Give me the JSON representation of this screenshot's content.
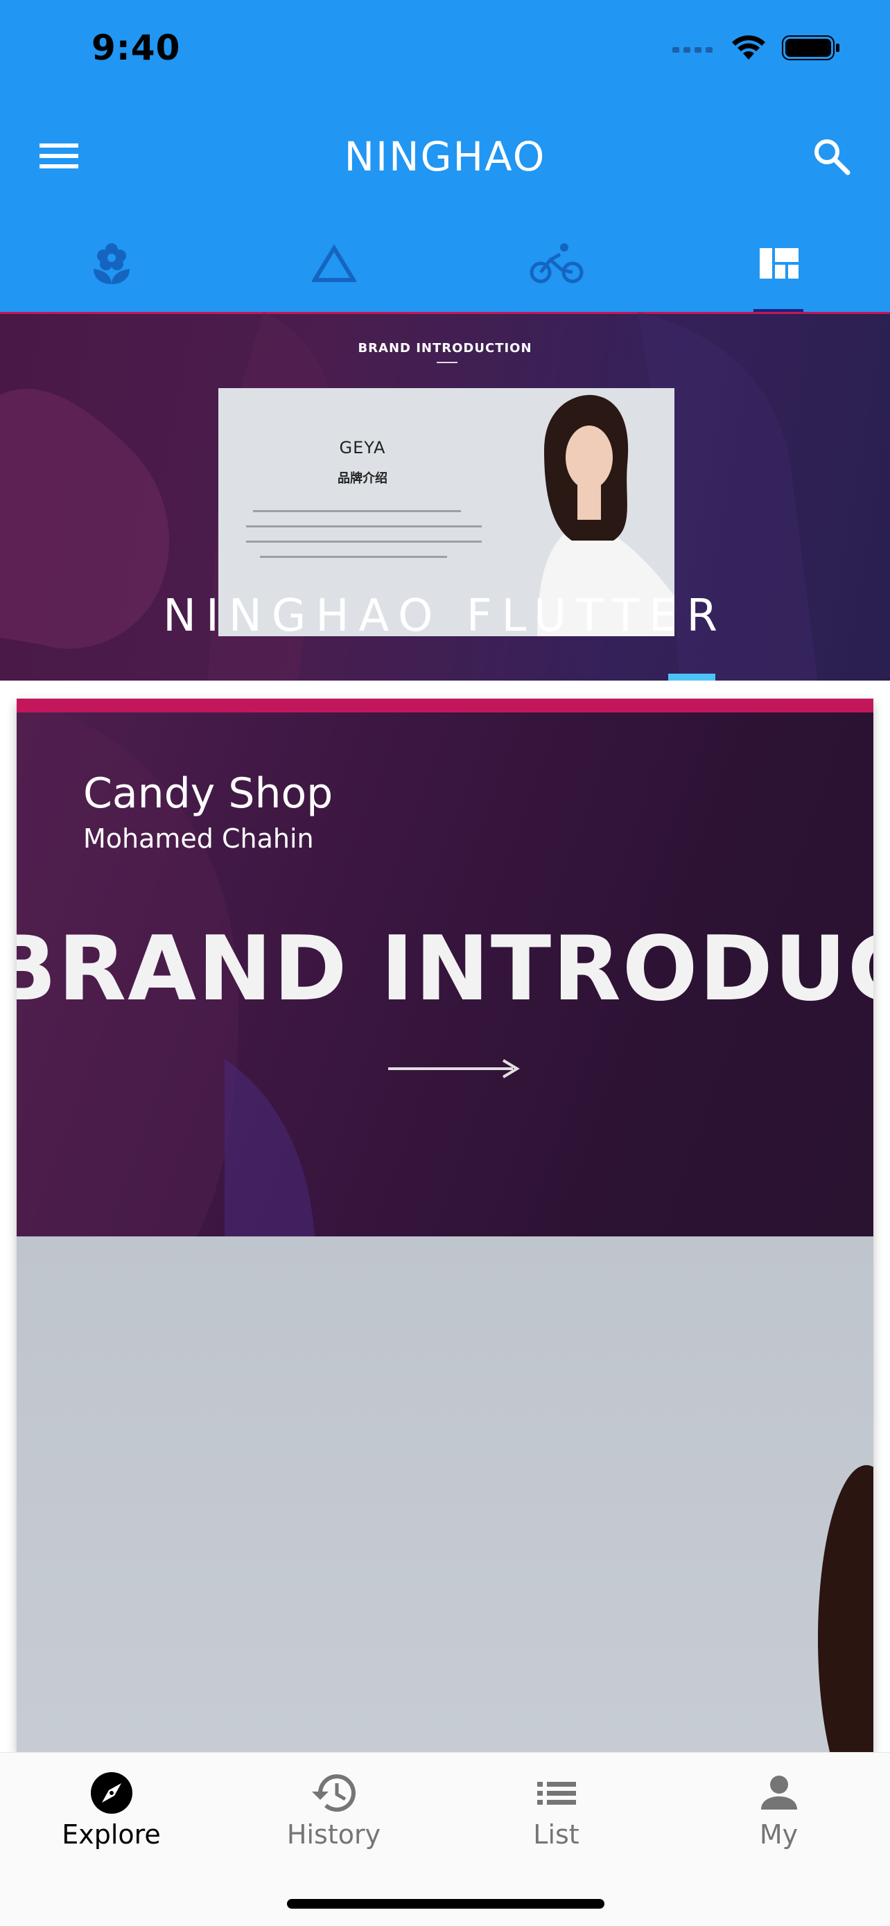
{
  "status_bar": {
    "time": "9:40"
  },
  "app_bar": {
    "title": "NINGHAO"
  },
  "tabs": [
    {
      "icon": "local-florist-icon"
    },
    {
      "icon": "change-history-icon"
    },
    {
      "icon": "directions-bike-icon"
    },
    {
      "icon": "view-quilt-icon",
      "selected": true
    }
  ],
  "banner": {
    "kicker": "BRAND INTRODUCTION",
    "brand": "GEYA",
    "brand_sub": "品牌介绍",
    "caption": "NINGHAO FLUTTER"
  },
  "card": {
    "title": "Candy Shop",
    "subtitle": "Mohamed Chahin",
    "hero_text": "BRAND INTRODUCTION"
  },
  "bottom_nav": [
    {
      "label": "Explore",
      "icon": "explore-icon",
      "selected": true
    },
    {
      "label": "History",
      "icon": "history-icon"
    },
    {
      "label": "List",
      "icon": "list-icon"
    },
    {
      "label": "My",
      "icon": "person-icon"
    }
  ],
  "colors": {
    "primary": "#2196f3",
    "accent": "#c2185b",
    "indicator": "#1a237e"
  }
}
